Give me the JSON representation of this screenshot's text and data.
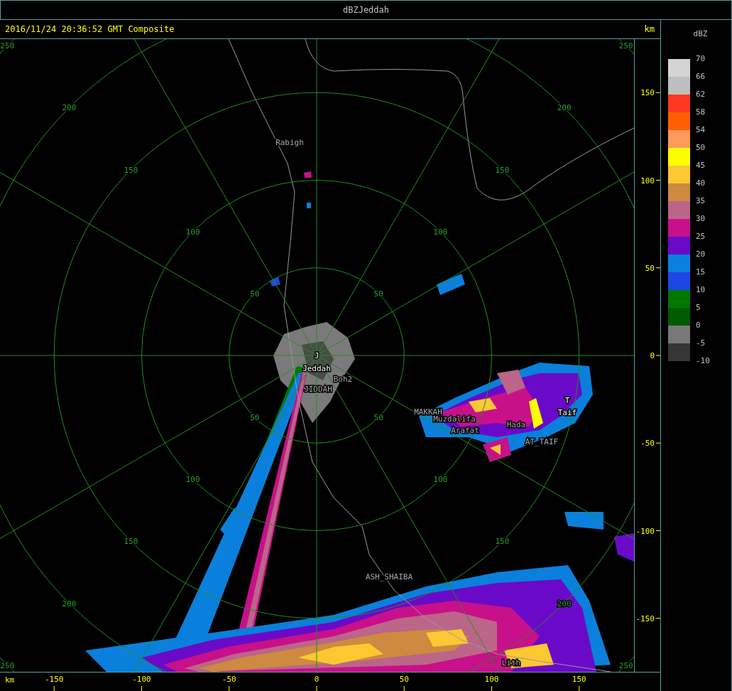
{
  "window": {
    "title": "dBZJeddah"
  },
  "header": {
    "timestamp": "2016/11/24 20:36:52 GMT Composite"
  },
  "range_rings": [
    {
      "labels": [
        "50",
        "50",
        "50",
        "50"
      ]
    },
    {
      "labels": [
        "100",
        "100",
        "100",
        "100"
      ]
    },
    {
      "labels": [
        "150",
        "150",
        "150",
        "150"
      ]
    },
    {
      "labels": [
        "200",
        "200",
        "200",
        "200"
      ]
    },
    {
      "labels": [
        "250",
        "250",
        "250",
        "250"
      ]
    }
  ],
  "places": [
    {
      "name": "Rabigh",
      "kind": "place"
    },
    {
      "name": "J",
      "kind": "radar-site"
    },
    {
      "name": "Jeddah",
      "kind": "radar-site"
    },
    {
      "name": "Boh2",
      "kind": "place"
    },
    {
      "name": "JIDDAH",
      "kind": "place"
    },
    {
      "name": "MAKKAH",
      "kind": "place"
    },
    {
      "name": "Muzdalifa",
      "kind": "place"
    },
    {
      "name": "Arafat",
      "kind": "place"
    },
    {
      "name": "Hada",
      "kind": "place"
    },
    {
      "name": "T",
      "kind": "radar-site"
    },
    {
      "name": "Taif",
      "kind": "radar-site"
    },
    {
      "name": "AT_TAIF",
      "kind": "place"
    },
    {
      "name": "ASH_SHAIBA",
      "kind": "place"
    },
    {
      "name": "Lith",
      "kind": "place"
    }
  ],
  "y_axis": {
    "unit": "km",
    "ticks": [
      "150",
      "100",
      "50",
      "0",
      "-50",
      "-100",
      "-150"
    ]
  },
  "x_axis": {
    "unit": "km",
    "ticks": [
      "-150",
      "-100",
      "-50",
      "0",
      "50",
      "100",
      "150"
    ]
  },
  "legend": {
    "title": "dBZ",
    "labels": [
      "70",
      "66",
      "62",
      "58",
      "54",
      "50",
      "45",
      "40",
      "35",
      "30",
      "25",
      "20",
      "15",
      "10",
      "5",
      "0",
      "-5",
      "-10"
    ],
    "bins": [
      {
        "color": "#d4d4d4"
      },
      {
        "color": "#bebebe"
      },
      {
        "color": "#ff3820"
      },
      {
        "color": "#ff5f00"
      },
      {
        "color": "#ff9a5a"
      },
      {
        "color": "#ffff00"
      },
      {
        "color": "#fbc832"
      },
      {
        "color": "#cd8a40"
      },
      {
        "color": "#bb6688"
      },
      {
        "color": "#c8108a"
      },
      {
        "color": "#6a0ac8"
      },
      {
        "color": "#0a80dc"
      },
      {
        "color": "#1e46e6"
      },
      {
        "color": "#007800"
      },
      {
        "color": "#005a00"
      },
      {
        "color": "#787878"
      },
      {
        "color": "#363636"
      }
    ]
  }
}
